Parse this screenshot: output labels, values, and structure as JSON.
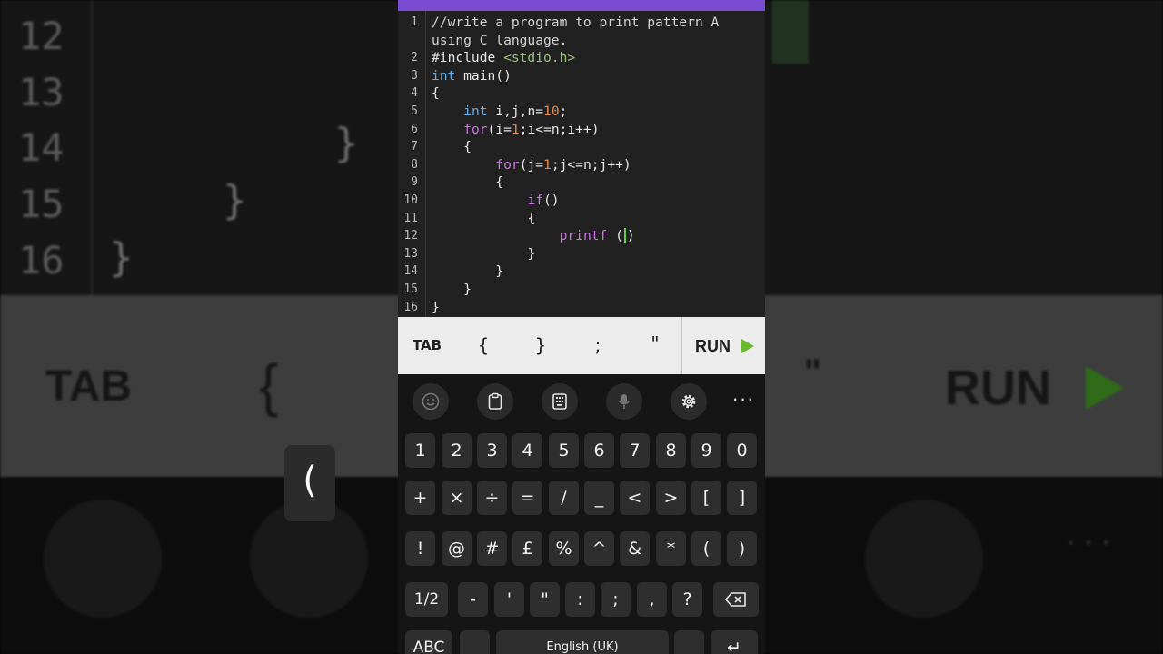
{
  "background": {
    "line_numbers": [
      "12",
      "13",
      "14",
      "15",
      "16"
    ],
    "braces": [
      "}",
      "}",
      "}"
    ],
    "tab_label": "TAB",
    "open_brace": "{",
    "quote": "\"",
    "run_label": "RUN"
  },
  "editor": {
    "lines": [
      {
        "num": "1",
        "text": "//write a program to print pattern A"
      },
      {
        "num": "",
        "text": "using C language."
      },
      {
        "num": "2",
        "text": "#include <stdio.h>"
      },
      {
        "num": "3",
        "text": "int main()"
      },
      {
        "num": "4",
        "text": "{"
      },
      {
        "num": "5",
        "text": "    int i,j,n=10;"
      },
      {
        "num": "6",
        "text": "    for(i=1;i<=n;i++)"
      },
      {
        "num": "7",
        "text": "    {"
      },
      {
        "num": "8",
        "text": "        for(j=1;j<=n;j++)"
      },
      {
        "num": "9",
        "text": "        {"
      },
      {
        "num": "10",
        "text": "            if()"
      },
      {
        "num": "11",
        "text": "            {"
      },
      {
        "num": "12",
        "text": "                printf ()"
      },
      {
        "num": "13",
        "text": "            }"
      },
      {
        "num": "14",
        "text": "        }"
      },
      {
        "num": "15",
        "text": "    }"
      },
      {
        "num": "16",
        "text": "}"
      }
    ]
  },
  "symbol_bar": {
    "tab": "TAB",
    "open_brace": "{",
    "close_brace": "}",
    "semicolon": ";",
    "quote": "\"",
    "run": "RUN"
  },
  "colors": {
    "top_bar": "#7b4bd1",
    "keyword": "#c678dd",
    "type": "#61afef",
    "number": "#e5894b",
    "string": "#98c379",
    "run_icon": "#6bb82e"
  },
  "keyboard": {
    "toolbar": [
      "smiley-icon",
      "clipboard-icon",
      "keyboard-icon",
      "microphone-icon",
      "gear-icon",
      "more-icon"
    ],
    "more_label": "···",
    "row1": [
      "1",
      "2",
      "3",
      "4",
      "5",
      "6",
      "7",
      "8",
      "9",
      "0"
    ],
    "row2": [
      "+",
      "×",
      "÷",
      "=",
      "/",
      "_",
      "<",
      ">",
      "[",
      "]"
    ],
    "row3": [
      "!",
      "@",
      "#",
      "£",
      "%",
      "^",
      "&",
      "*",
      "(",
      ")"
    ],
    "row4_left": "1/2",
    "row4": [
      "-",
      "'",
      "\"",
      ":",
      ";",
      ",",
      "?"
    ],
    "row5": {
      "abc": "ABC",
      "space": "English (UK)",
      "enter": "↵"
    },
    "popup": "("
  }
}
